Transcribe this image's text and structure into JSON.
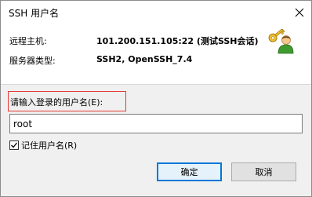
{
  "window": {
    "title": "SSH 用户名"
  },
  "info": {
    "host_label": "远程主机:",
    "host_value": "101.200.151.105:22 (测试SSH会话)",
    "server_label": "服务器类型:",
    "server_value": "SSH2, OpenSSH_7.4"
  },
  "form": {
    "prompt": "请输入登录的用户名(E):",
    "username_value": "root",
    "remember_label": "记住用户名(R)",
    "remember_checked": true
  },
  "buttons": {
    "ok_label": "确定",
    "cancel_label": "取消"
  },
  "icons": {
    "close": "close-icon",
    "key": "key-user-icon",
    "check": "check-icon"
  },
  "colors": {
    "highlight_border": "#e53935",
    "ok_border": "#0078d7"
  }
}
